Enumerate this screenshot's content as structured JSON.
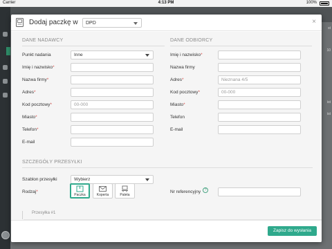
{
  "status_bar": {
    "carrier": "Carrier",
    "time": "4:13 PM",
    "battery": "100%"
  },
  "background": {
    "right_snippets": [
      "st",
      "10",
      "ist",
      "ist"
    ]
  },
  "modal": {
    "title": "Dodaj paczkę w",
    "carrier_value": "DPD",
    "close_glyph": "×",
    "sender": {
      "section_title": "DANE NADAWCY",
      "fields": [
        {
          "label": "Punkt nadania",
          "required": false,
          "value": "Inne",
          "type": "select"
        },
        {
          "label": "Imię i nazwisko",
          "required": true,
          "value": "",
          "type": "text"
        },
        {
          "label": "Nazwa firmy",
          "required": true,
          "value": "",
          "type": "text"
        },
        {
          "label": "Adres",
          "required": true,
          "value": "",
          "type": "text"
        },
        {
          "label": "Kod pocztowy",
          "required": true,
          "placeholder": "00-000",
          "type": "text"
        },
        {
          "label": "Miasto",
          "required": true,
          "value": "",
          "type": "text"
        },
        {
          "label": "Telefon",
          "required": true,
          "value": "",
          "type": "text"
        },
        {
          "label": "E-mail",
          "required": false,
          "value": "",
          "type": "text"
        }
      ]
    },
    "receiver": {
      "section_title": "DANE ODBIORCY",
      "fields": [
        {
          "label": "Imię i nazwisko",
          "required": true,
          "value": "",
          "type": "text"
        },
        {
          "label": "Nazwa firmy",
          "required": false,
          "value": "",
          "type": "text"
        },
        {
          "label": "Adres",
          "required": true,
          "value": "Nieznana 4/5",
          "type": "text"
        },
        {
          "label": "Kod pocztowy",
          "required": true,
          "placeholder": "00-000",
          "type": "text"
        },
        {
          "label": "Miasto",
          "required": true,
          "value": "",
          "type": "text"
        },
        {
          "label": "Telefon",
          "required": false,
          "value": "",
          "type": "text"
        },
        {
          "label": "E-mail",
          "required": false,
          "value": "",
          "type": "text"
        }
      ]
    },
    "shipment": {
      "section_title": "SZCZEGÓŁY PRZESYŁKI",
      "template_label": "Szablon przesyłki",
      "template_value": "Wybierz",
      "type_label": "Rodzaj",
      "types": [
        {
          "label": "Paczka",
          "selected": true,
          "icon": "package-icon"
        },
        {
          "label": "Koperta",
          "selected": false,
          "icon": "envelope-icon"
        },
        {
          "label": "Paleta",
          "selected": false,
          "icon": "pallet-icon"
        }
      ],
      "reference_label": "Nr referencyjny",
      "reference_help": "?",
      "reference_value": ""
    },
    "package_tab": "Przesyłka #1",
    "save_label": "Zapisz do wysłania"
  },
  "colors": {
    "accent": "#2fa98c",
    "required": "#d9534f",
    "overlay": "#6b6e70"
  }
}
